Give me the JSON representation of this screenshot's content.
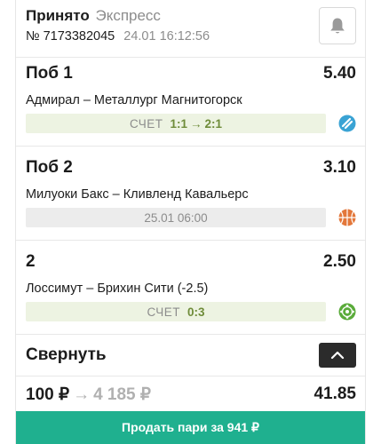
{
  "header": {
    "status": "Принято",
    "type": "Экспресс",
    "bet_number": "№ 7173382045",
    "timestamp": "24.01 16:12:56",
    "bell_icon": "bell-icon"
  },
  "events": [
    {
      "title": "Поб 1",
      "odd": "5.40",
      "teams": "Адмирал – Металлург Магнитогорск",
      "info_label": "СЧЕТ",
      "score_from": "1:1",
      "score_to": "2:1",
      "sport": "hockey-puck-icon"
    },
    {
      "title": "Поб 2",
      "odd": "3.10",
      "teams": "Милуоки Бакс – Кливленд Кавальерс",
      "info_text": "25.01 06:00",
      "sport": "basketball-icon"
    },
    {
      "title": "2",
      "odd": "2.50",
      "teams": "Лоссимут – Брихин Сити (-2.5)",
      "info_label": "СЧЕТ",
      "score": "0:3",
      "sport": "soccer-ball-icon"
    }
  ],
  "collapse": {
    "label": "Свернуть",
    "icon": "chevron-up-icon"
  },
  "summary": {
    "stake": "100 ₽",
    "potential_win": "4 185 ₽",
    "total_odd": "41.85"
  },
  "sell_button": {
    "label": "Продать пари за 941 ₽"
  },
  "colors": {
    "accent": "#1fb08f",
    "live_bg": "#edf3e2",
    "score_green": "#6f8c3a",
    "pre_bg": "#ececec",
    "dark_button": "#2b2b2b"
  }
}
